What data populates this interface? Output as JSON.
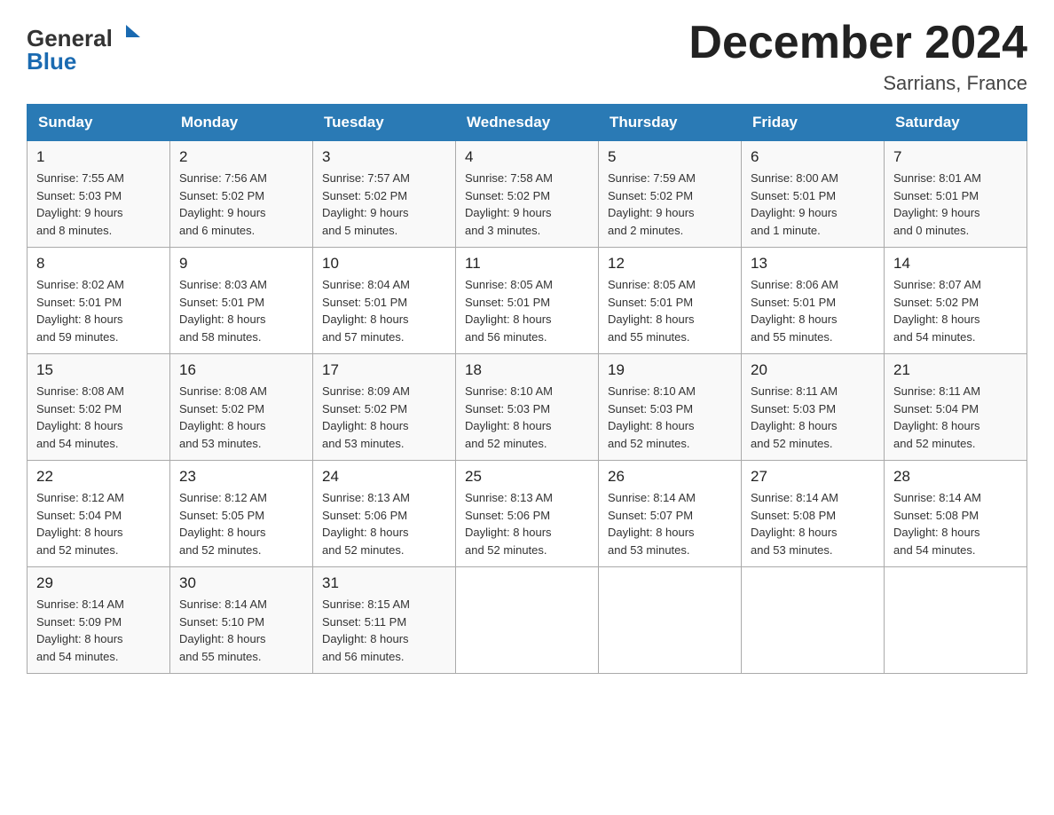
{
  "header": {
    "logo_general": "General",
    "logo_blue": "Blue",
    "month_title": "December 2024",
    "location": "Sarrians, France"
  },
  "days_of_week": [
    "Sunday",
    "Monday",
    "Tuesday",
    "Wednesday",
    "Thursday",
    "Friday",
    "Saturday"
  ],
  "weeks": [
    [
      {
        "day": "1",
        "sunrise": "7:55 AM",
        "sunset": "5:03 PM",
        "daylight": "9 hours and 8 minutes."
      },
      {
        "day": "2",
        "sunrise": "7:56 AM",
        "sunset": "5:02 PM",
        "daylight": "9 hours and 6 minutes."
      },
      {
        "day": "3",
        "sunrise": "7:57 AM",
        "sunset": "5:02 PM",
        "daylight": "9 hours and 5 minutes."
      },
      {
        "day": "4",
        "sunrise": "7:58 AM",
        "sunset": "5:02 PM",
        "daylight": "9 hours and 3 minutes."
      },
      {
        "day": "5",
        "sunrise": "7:59 AM",
        "sunset": "5:02 PM",
        "daylight": "9 hours and 2 minutes."
      },
      {
        "day": "6",
        "sunrise": "8:00 AM",
        "sunset": "5:01 PM",
        "daylight": "9 hours and 1 minute."
      },
      {
        "day": "7",
        "sunrise": "8:01 AM",
        "sunset": "5:01 PM",
        "daylight": "9 hours and 0 minutes."
      }
    ],
    [
      {
        "day": "8",
        "sunrise": "8:02 AM",
        "sunset": "5:01 PM",
        "daylight": "8 hours and 59 minutes."
      },
      {
        "day": "9",
        "sunrise": "8:03 AM",
        "sunset": "5:01 PM",
        "daylight": "8 hours and 58 minutes."
      },
      {
        "day": "10",
        "sunrise": "8:04 AM",
        "sunset": "5:01 PM",
        "daylight": "8 hours and 57 minutes."
      },
      {
        "day": "11",
        "sunrise": "8:05 AM",
        "sunset": "5:01 PM",
        "daylight": "8 hours and 56 minutes."
      },
      {
        "day": "12",
        "sunrise": "8:05 AM",
        "sunset": "5:01 PM",
        "daylight": "8 hours and 55 minutes."
      },
      {
        "day": "13",
        "sunrise": "8:06 AM",
        "sunset": "5:01 PM",
        "daylight": "8 hours and 55 minutes."
      },
      {
        "day": "14",
        "sunrise": "8:07 AM",
        "sunset": "5:02 PM",
        "daylight": "8 hours and 54 minutes."
      }
    ],
    [
      {
        "day": "15",
        "sunrise": "8:08 AM",
        "sunset": "5:02 PM",
        "daylight": "8 hours and 54 minutes."
      },
      {
        "day": "16",
        "sunrise": "8:08 AM",
        "sunset": "5:02 PM",
        "daylight": "8 hours and 53 minutes."
      },
      {
        "day": "17",
        "sunrise": "8:09 AM",
        "sunset": "5:02 PM",
        "daylight": "8 hours and 53 minutes."
      },
      {
        "day": "18",
        "sunrise": "8:10 AM",
        "sunset": "5:03 PM",
        "daylight": "8 hours and 52 minutes."
      },
      {
        "day": "19",
        "sunrise": "8:10 AM",
        "sunset": "5:03 PM",
        "daylight": "8 hours and 52 minutes."
      },
      {
        "day": "20",
        "sunrise": "8:11 AM",
        "sunset": "5:03 PM",
        "daylight": "8 hours and 52 minutes."
      },
      {
        "day": "21",
        "sunrise": "8:11 AM",
        "sunset": "5:04 PM",
        "daylight": "8 hours and 52 minutes."
      }
    ],
    [
      {
        "day": "22",
        "sunrise": "8:12 AM",
        "sunset": "5:04 PM",
        "daylight": "8 hours and 52 minutes."
      },
      {
        "day": "23",
        "sunrise": "8:12 AM",
        "sunset": "5:05 PM",
        "daylight": "8 hours and 52 minutes."
      },
      {
        "day": "24",
        "sunrise": "8:13 AM",
        "sunset": "5:06 PM",
        "daylight": "8 hours and 52 minutes."
      },
      {
        "day": "25",
        "sunrise": "8:13 AM",
        "sunset": "5:06 PM",
        "daylight": "8 hours and 52 minutes."
      },
      {
        "day": "26",
        "sunrise": "8:14 AM",
        "sunset": "5:07 PM",
        "daylight": "8 hours and 53 minutes."
      },
      {
        "day": "27",
        "sunrise": "8:14 AM",
        "sunset": "5:08 PM",
        "daylight": "8 hours and 53 minutes."
      },
      {
        "day": "28",
        "sunrise": "8:14 AM",
        "sunset": "5:08 PM",
        "daylight": "8 hours and 54 minutes."
      }
    ],
    [
      {
        "day": "29",
        "sunrise": "8:14 AM",
        "sunset": "5:09 PM",
        "daylight": "8 hours and 54 minutes."
      },
      {
        "day": "30",
        "sunrise": "8:14 AM",
        "sunset": "5:10 PM",
        "daylight": "8 hours and 55 minutes."
      },
      {
        "day": "31",
        "sunrise": "8:15 AM",
        "sunset": "5:11 PM",
        "daylight": "8 hours and 56 minutes."
      },
      null,
      null,
      null,
      null
    ]
  ]
}
